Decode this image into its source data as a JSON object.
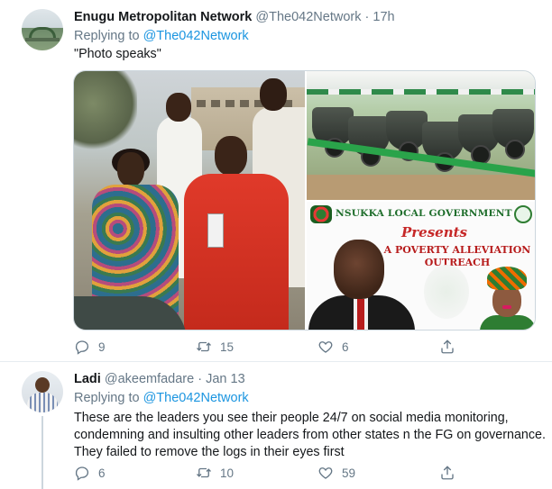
{
  "tweets": [
    {
      "author_name": "Enugu Metropolitan Network",
      "author_handle": "@The042Network",
      "separator": "·",
      "time": "17h",
      "replying_prefix": "Replying to",
      "replying_to": "@The042Network",
      "text": "\"Photo speaks\"",
      "media": {
        "poster_lga": "NSUKKA LOCAL GOVERNMENT",
        "poster_presents": "Presents",
        "poster_title": "A POVERTY ALLEVIATION OUTREACH"
      },
      "actions": {
        "reply_count": "9",
        "retweet_count": "15",
        "like_count": "6"
      }
    },
    {
      "author_name": "Ladi",
      "author_handle": "@akeemfadare",
      "separator": "·",
      "time": "Jan 13",
      "replying_prefix": "Replying to",
      "replying_to": "@The042Network",
      "text": "These are the leaders you see their people 24/7 on social media monitoring, condemning and insulting other leaders from other states n the FG on governance. They failed to remove the logs in their eyes first",
      "actions": {
        "reply_count": "6",
        "retweet_count": "10",
        "like_count": "59"
      }
    }
  ],
  "icons": {
    "reply": "reply-icon",
    "retweet": "retweet-icon",
    "like": "heart-icon",
    "share": "share-icon"
  },
  "colors": {
    "text_primary": "#14171a",
    "text_secondary": "#657786",
    "link": "#1b95e0",
    "divider": "#e6ecf0"
  }
}
